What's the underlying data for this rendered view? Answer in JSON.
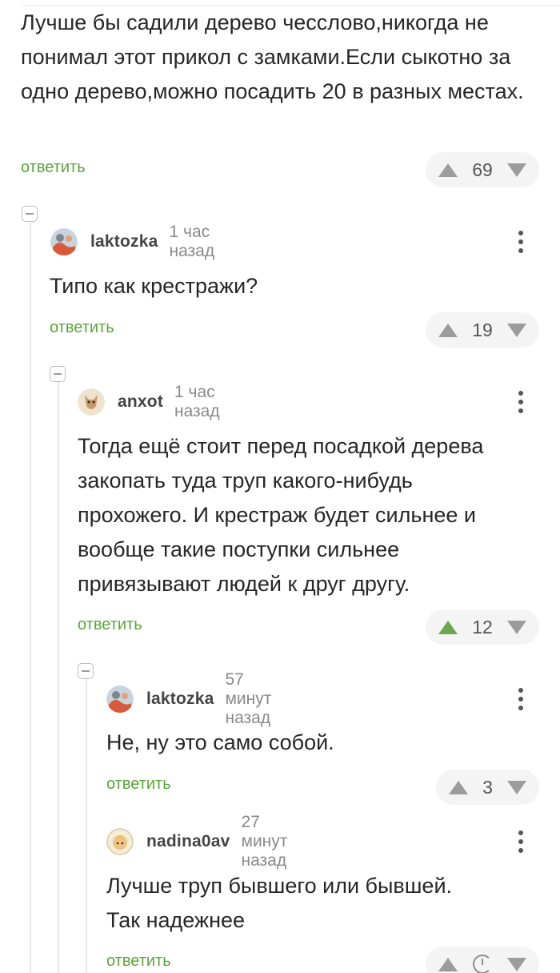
{
  "comment0": {
    "text": "Лучше бы садили дерево чесслово,никогда не понимал этот прикол с замками.Если сыкотно за одно дерево,можно посадить 20 в разных местах.",
    "reply_label": "ответить",
    "score": "69"
  },
  "comment1": {
    "author": "laktozka",
    "time": "1 час назад",
    "text": "Типо как крестражи?",
    "reply_label": "ответить",
    "score": "19"
  },
  "comment2": {
    "author": "anxot",
    "time": "1 час назад",
    "text": "Тогда ещё стоит перед посадкой дерева закопать туда труп какого-нибудь прохожего. И крестраж будет сильнее и вообще такие поступки сильнее привязывают людей к друг другу.",
    "reply_label": "ответить",
    "score": "12",
    "upvoted": true
  },
  "comment3": {
    "author": "laktozka",
    "time": "57 минут назад",
    "text": "Не, ну это само собой.",
    "reply_label": "ответить",
    "score": "3"
  },
  "comment4": {
    "author": "nadina0av",
    "time": "27 минут назад",
    "text": "Лучше труп бывшего или бывшей. Так надежнее",
    "reply_label": "ответить",
    "score_icon": "clock-icon"
  },
  "colors": {
    "accent_green": "#5aa53a",
    "upvote_active": "#6aa84f"
  },
  "icons": {
    "more": "more-vertical-icon",
    "upvote": "arrow-up-icon",
    "downvote": "arrow-down-icon",
    "collapse": "collapse-minus-icon"
  }
}
